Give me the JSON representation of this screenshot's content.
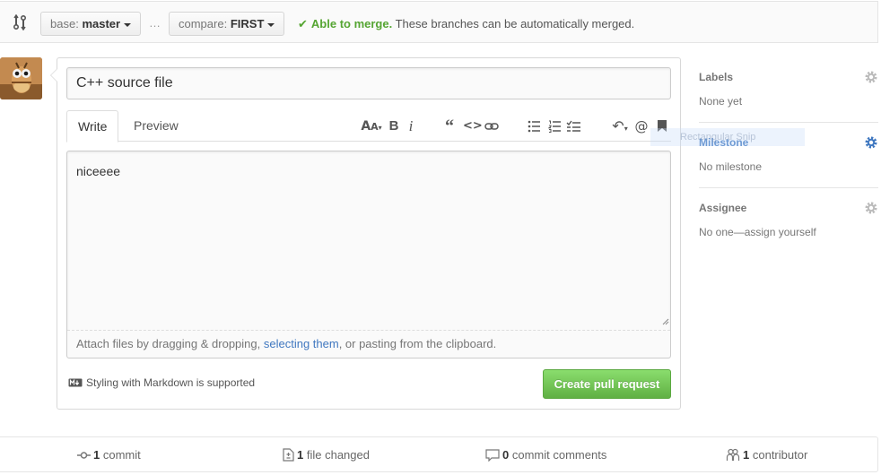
{
  "compare": {
    "base_prefix": "base:",
    "base_branch": "master",
    "separator": "…",
    "compare_prefix": "compare:",
    "compare_branch": "FIRST",
    "merge_ok": "Able to merge.",
    "merge_desc": "These branches can be automatically merged."
  },
  "form": {
    "title_value": "C++ source file",
    "tabs": [
      {
        "label": "Write",
        "active": true
      },
      {
        "label": "Preview",
        "active": false
      }
    ],
    "toolbar_icons": [
      "text-size-icon",
      "bold-icon",
      "italic-icon",
      "quote-icon",
      "code-icon",
      "link-icon",
      "unordered-list-icon",
      "ordered-list-icon",
      "task-list-icon",
      "reply-icon",
      "mention-icon",
      "bookmark-icon"
    ],
    "comment_value": "niceeee",
    "attach": {
      "before": "Attach files by dragging & dropping, ",
      "link": "selecting them",
      "after": ", or pasting from the clipboard."
    },
    "markdown_note": "Styling with Markdown is supported",
    "create_button": "Create pull request"
  },
  "sidebar": {
    "labels": {
      "heading": "Labels",
      "value": "None yet"
    },
    "milestone": {
      "heading": "Milestone",
      "value": "No milestone"
    },
    "assignee": {
      "heading": "Assignee",
      "value": "No one—assign yourself"
    },
    "snip_overlay": "Rectangular Snip"
  },
  "summary": {
    "commits": {
      "count": "1",
      "label": "commit"
    },
    "files": {
      "count": "1",
      "label": "file changed"
    },
    "comments": {
      "count": "0",
      "label": "commit comments"
    },
    "contributors": {
      "count": "1",
      "label": "contributor"
    }
  },
  "colors": {
    "green": "#55a532",
    "link_blue": "#4078c0",
    "button_green": "#60b044"
  }
}
